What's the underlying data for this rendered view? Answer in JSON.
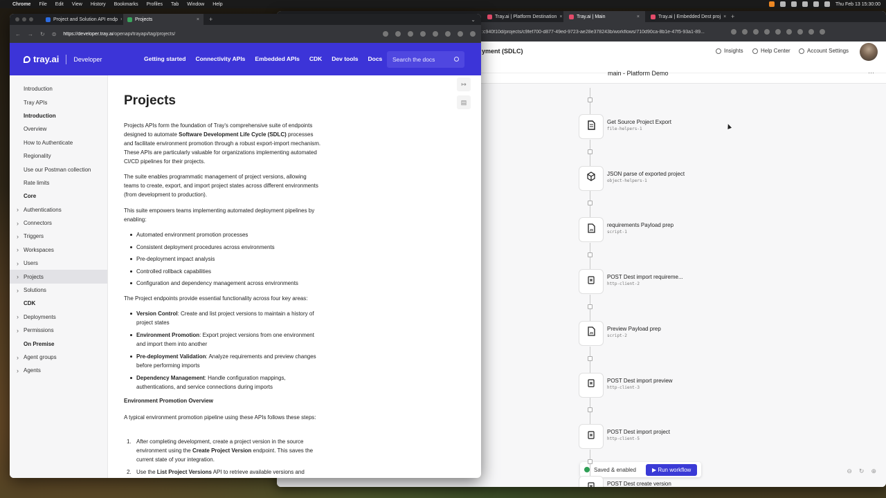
{
  "menubar": {
    "apple": "",
    "items": [
      "Chrome",
      "File",
      "Edit",
      "View",
      "History",
      "Bookmarks",
      "Profiles",
      "Tab",
      "Window",
      "Help"
    ],
    "clock": "Thu Feb 13  15:30:00"
  },
  "back_window": {
    "tabs": [
      {
        "label": "Tray.ai | Platform Destination"
      },
      {
        "label": "Tray.ai | Main"
      },
      {
        "label": "Tray.ai | Embedded Dest proj"
      }
    ],
    "url": ":c940f10d/projects/c9fef700-d877-49ed-9723-ae28e378243b/workflows/710d90ca-8b1e-47f5-93a1-89...",
    "app_title": "yment (SDLC)",
    "header_links": {
      "insights": "Insights",
      "help": "Help Center",
      "settings": "Account Settings"
    },
    "workflow_name": "main - Platform Demo",
    "steps": [
      {
        "title": "Get Source Project Export",
        "sub": "file-helpers-1",
        "icon": "file-icon"
      },
      {
        "title": "JSON parse of exported project",
        "sub": "object-helpers-1",
        "icon": "cube-icon"
      },
      {
        "title": "requirements Payload prep",
        "sub": "script-1",
        "icon": "js-file-icon"
      },
      {
        "title": "POST Dest import requireme...",
        "sub": "http-client-2",
        "icon": "http-icon"
      },
      {
        "title": "Preview Payload prep",
        "sub": "script-2",
        "icon": "js-file-icon"
      },
      {
        "title": "POST Dest import preview",
        "sub": "http-client-3",
        "icon": "http-icon"
      },
      {
        "title": "POST Dest import project",
        "sub": "http-client-5",
        "icon": "http-icon"
      },
      {
        "title": "POST Dest create version",
        "sub": "",
        "icon": "http-icon"
      }
    ],
    "status": "Saved & enabled",
    "run_button": "Run workflow"
  },
  "front_window": {
    "tabs": [
      {
        "label": "Project and Solution API endp"
      },
      {
        "label": "Projects"
      }
    ],
    "url_host": "https://developer.tray.ai",
    "url_path": "/openapi/trayapi/tag/projects/",
    "logo": "tray.ai",
    "logo_sub": "Developer",
    "nav": [
      "Getting started",
      "Connectivity APIs",
      "Embedded APIs",
      "CDK",
      "Dev tools",
      "Docs"
    ],
    "search_placeholder": "Search the docs",
    "sidebar": [
      {
        "label": "Introduction",
        "type": "item"
      },
      {
        "label": "Tray APIs",
        "type": "item"
      },
      {
        "label": "Introduction",
        "type": "heading"
      },
      {
        "label": "Overview",
        "type": "item"
      },
      {
        "label": "How to Authenticate",
        "type": "item"
      },
      {
        "label": "Regionality",
        "type": "item"
      },
      {
        "label": "Use our Postman collection",
        "type": "item"
      },
      {
        "label": "Rate limits",
        "type": "item"
      },
      {
        "label": "Core",
        "type": "heading"
      },
      {
        "label": "Authentications",
        "type": "caret"
      },
      {
        "label": "Connectors",
        "type": "caret"
      },
      {
        "label": "Triggers",
        "type": "caret"
      },
      {
        "label": "Workspaces",
        "type": "caret"
      },
      {
        "label": "Users",
        "type": "caret"
      },
      {
        "label": "Projects",
        "type": "selected"
      },
      {
        "label": "Solutions",
        "type": "caret"
      },
      {
        "label": "CDK",
        "type": "heading"
      },
      {
        "label": "Deployments",
        "type": "caret"
      },
      {
        "label": "Permissions",
        "type": "caret"
      },
      {
        "label": "On Premise",
        "type": "heading"
      },
      {
        "label": "Agent groups",
        "type": "caret"
      },
      {
        "label": "Agents",
        "type": "caret"
      }
    ],
    "content": {
      "title": "Projects",
      "p1_a": "Projects APIs form the foundation of Tray's comprehensive suite of endpoints designed to automate ",
      "p1_b": "Software Development Life Cycle (SDLC)",
      "p1_c": " processes and facilitate environment promotion through a robust export-import mechanism. These APIs are particularly valuable for organizations implementing automated CI/CD pipelines for their projects.",
      "p2": "The suite enables programmatic management of project versions, allowing teams to create, export, and import project states across different environments (from development to production).",
      "p3": "This suite empowers teams implementing automated deployment pipelines by enabling:",
      "bullets1": [
        "Automated environment promotion processes",
        "Consistent deployment procedures across environments",
        "Pre-deployment impact analysis",
        "Controlled rollback capabilities",
        "Configuration and dependency management across environments"
      ],
      "p4": "The Project endpoints provide essential functionality across four key areas:",
      "areas": [
        {
          "b": "Version Control",
          "t": ": Create and list project versions to maintain a history of project states"
        },
        {
          "b": "Environment Promotion",
          "t": ": Export project versions from one environment and import them into another"
        },
        {
          "b": "Pre-deployment Validation",
          "t": ": Analyze requirements and preview changes before performing imports"
        },
        {
          "b": "Dependency Management",
          "t": ": Handle configuration mappings, authentications, and service connections during imports"
        }
      ],
      "h_overview": "Environment Promotion Overview",
      "p5": "A typical environment promotion pipeline using these APIs follows these steps:",
      "step1_a": "After completing development, create a project version in the source environment using the ",
      "step1_b": "Create Project Version",
      "step1_c": " endpoint. This saves the current state of your integration.",
      "step2_a": "Use the ",
      "step2_b": "List Project Versions",
      "step2_c": " API to retrieve available versions and"
    }
  }
}
